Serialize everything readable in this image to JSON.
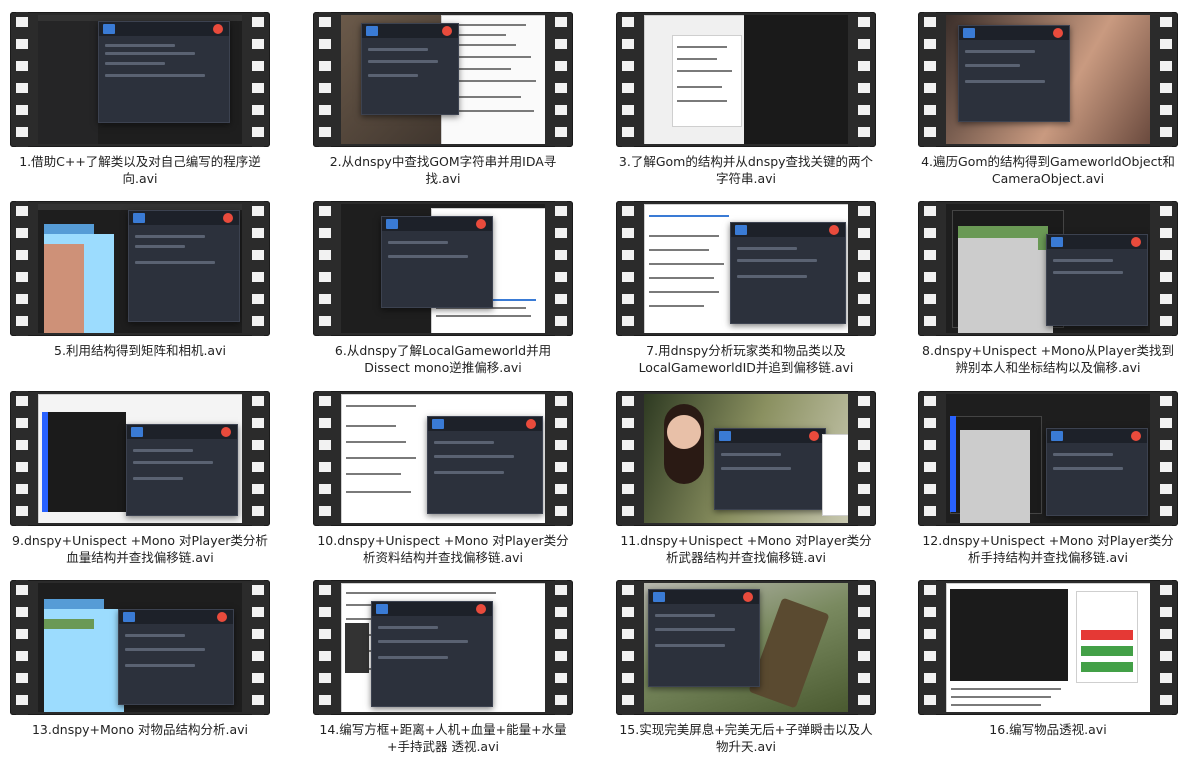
{
  "items": [
    {
      "title": "1.借助C++了解类以及对自己编写的程序逆向.avi",
      "thumb": "code-editor-with-recorder"
    },
    {
      "title": "2.从dnspy中查找GOM字符串并用IDA寻找.avi",
      "thumb": "notes-with-recorder"
    },
    {
      "title": "3.了解Gom的结构并从dnspy查找关键的两个字符串.avi",
      "thumb": "dialog-window"
    },
    {
      "title": "4.遍历Gom的结构得到GameworldObject和CameraObject.avi",
      "thumb": "photo-with-recorder"
    },
    {
      "title": "5.利用结构得到矩阵和相机.avi",
      "thumb": "code-editor-with-recorder"
    },
    {
      "title": "6.从dnspy了解LocalGameworld并用Dissect mono逆推偏移.avi",
      "thumb": "code-and-table"
    },
    {
      "title": "7.用dnspy分析玩家类和物品类以及LocalGameworldID并追到偏移链.avi",
      "thumb": "notes-with-recorder"
    },
    {
      "title": "8.dnspy+Unispect +Mono从Player类找到辨别本人和坐标结构以及偏移.avi",
      "thumb": "type-inspector"
    },
    {
      "title": "9.dnspy+Unispect +Mono 对Player类分析血量结构并查找偏移链.avi",
      "thumb": "type-inspector"
    },
    {
      "title": "10.dnspy+Unispect +Mono 对Player类分析资料结构并查找偏移链.avi",
      "thumb": "notes-with-recorder"
    },
    {
      "title": "11.dnspy+Unispect +Mono 对Player类分析武器结构并查找偏移链.avi",
      "thumb": "photo-with-recorder"
    },
    {
      "title": "12.dnspy+Unispect +Mono 对Player类分析手持结构并查找偏移链.avi",
      "thumb": "type-inspector"
    },
    {
      "title": "13.dnspy+Mono  对物品结构分析.avi",
      "thumb": "code-editor-with-recorder"
    },
    {
      "title": "14.编写方框+距离+人机+血量+能量+水量+手持武器 透视.avi",
      "thumb": "notes-with-recorder"
    },
    {
      "title": "15.实现完美屏息+完美无后+子弹瞬击以及人物升天.avi",
      "thumb": "game-with-recorder"
    },
    {
      "title": "16.编写物品透视.avi",
      "thumb": "menu-panel"
    }
  ],
  "colors": {
    "film": "#2b2b2b",
    "recorder_panel": "#2c313c",
    "record_button": "#e94b3c",
    "accent_blue": "#3a7bd5"
  }
}
